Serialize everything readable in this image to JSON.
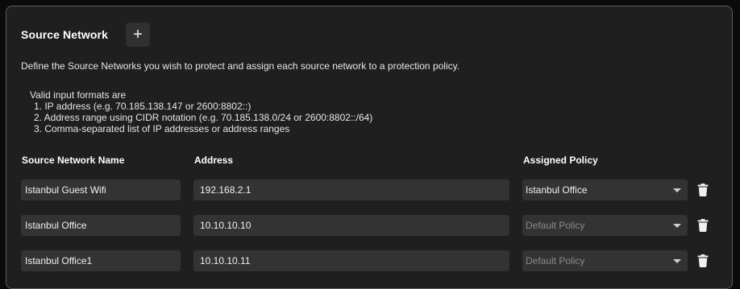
{
  "section": {
    "title": "Source Network",
    "add_label": "+",
    "description": "Define the Source Networks you wish to protect and assign each source network to a protection policy.",
    "formats_intro": "Valid input formats are",
    "formats": [
      "1. IP address (e.g. 70.185.138.147 or 2600:8802::)",
      "2. Address range using CIDR notation (e.g. 70.185.138.0/24 or 2600:8802::/64)",
      "3. Comma-separated list of IP addresses or address ranges"
    ]
  },
  "columns": {
    "name": "Source Network Name",
    "address": "Address",
    "policy": "Assigned Policy"
  },
  "rows": [
    {
      "name": "Istanbul Guest Wifi",
      "address": "192.168.2.1",
      "policy": "Istanbul Office",
      "policy_is_placeholder": false
    },
    {
      "name": "Istanbul Office",
      "address": "10.10.10.10",
      "policy": "Default Policy",
      "policy_is_placeholder": true
    },
    {
      "name": "Istanbul Office1",
      "address": "10.10.10.11",
      "policy": "Default Policy",
      "policy_is_placeholder": true
    }
  ],
  "icons": {
    "add": "plus-icon",
    "dropdown": "chevron-down-icon",
    "delete": "trash-icon"
  },
  "colors": {
    "background": "#1f1f1f",
    "field": "#333333",
    "border": "#5a5a5a",
    "placeholder": "#8a8a8a"
  }
}
